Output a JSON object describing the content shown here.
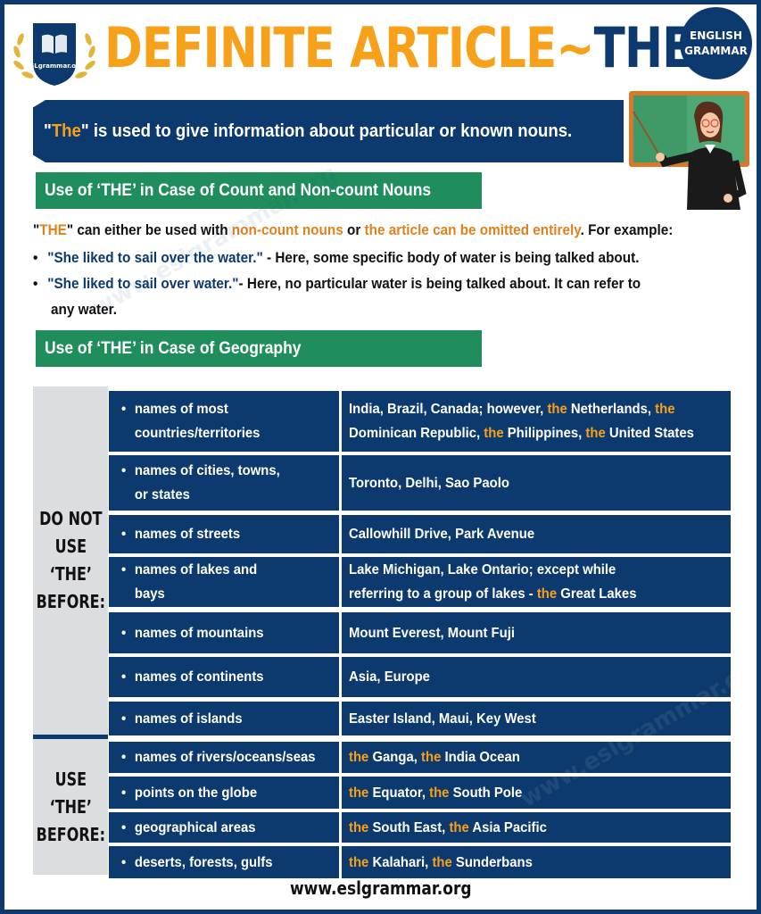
{
  "header": {
    "logo_text": "ESLgrammar.org",
    "title_part1": "DEFINITE ARTICLE~",
    "title_part2": "THE",
    "badge_line1": "ENGLISH",
    "badge_line2": "GRAMMAR"
  },
  "banner": {
    "open_quote": "\"",
    "highlight": "The",
    "text": "\" is used to give information about particular or known nouns."
  },
  "section1": {
    "heading": "Use of ‘THE’ in Case of Count and Non-count Nouns",
    "intro": {
      "q1": "\"",
      "the": "THE",
      "q2": "\" can either be used with ",
      "hl1": "non-count nouns",
      "mid": " or ",
      "hl2": "the article can be omitted entirely",
      "end": ". For example:"
    },
    "bullets": [
      {
        "quote": "\"She liked to sail over the water.\"",
        "text": " - Here, some specific body of water is being talked about."
      },
      {
        "quote": "\"She liked to sail over water.\"",
        "text": "- Here, no particular water is being talked about. It can refer to",
        "continuation": "any water."
      }
    ]
  },
  "section2": {
    "heading": "Use of ‘THE’ in Case of Geography",
    "groups": [
      {
        "label": [
          "DO NOT",
          "USE",
          "‘THE’",
          "BEFORE:"
        ],
        "rows": [
          {
            "category": [
              "names of most",
              "countries/territories"
            ],
            "examples": [
              [
                "India, Brazil, Canada; however, ",
                "the",
                " Netherlands, ",
                "the"
              ],
              [
                "Dominican Republic, ",
                "the",
                " Philippines, ",
                "the",
                " United States"
              ]
            ]
          },
          {
            "category": [
              "names of cities, towns,",
              "or states"
            ],
            "examples": [
              [
                "Toronto, Delhi, Sao Paolo"
              ]
            ]
          },
          {
            "category": [
              "names of streets"
            ],
            "examples": [
              [
                "Callowhill Drive, Park Avenue"
              ]
            ]
          },
          {
            "category": [
              "names of lakes and",
              "bays"
            ],
            "examples": [
              [
                "Lake Michigan, Lake Ontario; except while"
              ],
              [
                "referring to a group of lakes - ",
                "the",
                " Great Lakes"
              ]
            ]
          },
          {
            "category": [
              "names of mountains"
            ],
            "examples": [
              [
                "Mount Everest, Mount Fuji"
              ]
            ]
          },
          {
            "category": [
              "names of continents"
            ],
            "examples": [
              [
                "Asia, Europe"
              ]
            ]
          },
          {
            "category": [
              "names of islands"
            ],
            "examples": [
              [
                "Easter Island, Maui, Key West"
              ]
            ]
          }
        ]
      },
      {
        "label": [
          "USE",
          "‘THE’",
          "BEFORE:"
        ],
        "rows": [
          {
            "category": [
              "names of rivers/oceans/seas"
            ],
            "examples": [
              [
                "",
                "the",
                " Ganga, ",
                "the",
                " India Ocean"
              ]
            ]
          },
          {
            "category": [
              "points on the globe"
            ],
            "examples": [
              [
                "",
                "the",
                " Equator, ",
                "the",
                " South Pole"
              ]
            ]
          },
          {
            "category": [
              "geographical areas"
            ],
            "examples": [
              [
                "",
                "the",
                " South East, ",
                "the",
                " Asia Pacific"
              ]
            ]
          },
          {
            "category": [
              "deserts, forests, gulfs"
            ],
            "examples": [
              [
                "",
                "the",
                " Kalahari, ",
                "the",
                " Sunderbans"
              ]
            ]
          }
        ]
      }
    ]
  },
  "watermark": "www.eslgrammar.org",
  "footer": {
    "url": "www.eslgrammar.org"
  },
  "colors": {
    "navy": "#0d3a6e",
    "orange": "#f7a11a",
    "green": "#1f8e5c",
    "gray": "#dcdde0"
  }
}
